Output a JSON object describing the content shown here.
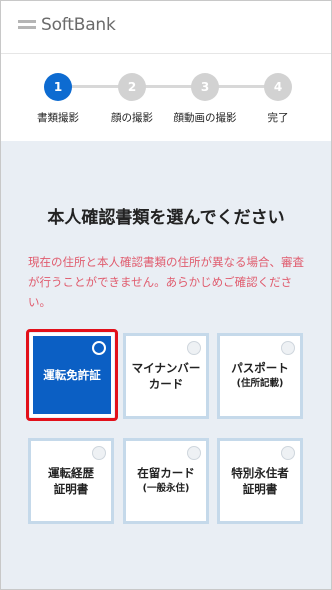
{
  "header": {
    "logo_text": "SoftBank"
  },
  "stepper": {
    "steps": [
      {
        "number": "1",
        "label": "書類撮影"
      },
      {
        "number": "2",
        "label": "顔の撮影"
      },
      {
        "number": "3",
        "label": "顔動画の撮影"
      },
      {
        "number": "4",
        "label": "完了"
      }
    ],
    "active_step": 1
  },
  "main": {
    "title": "本人確認書類を選んでください",
    "notice": "現在の住所と本人確認書類の住所が異なる場合、審査が行うことができません。あらかじめご確認ください。",
    "documents": [
      {
        "line1": "運転免許証",
        "line2": "",
        "selected": true
      },
      {
        "line1": "マイナンバー",
        "line2": "カード",
        "selected": false
      },
      {
        "line1": "パスポート",
        "line2": "(住所記載)",
        "selected": false
      },
      {
        "line1": "運転経歴",
        "line2": "証明書",
        "selected": false
      },
      {
        "line1": "在留カード",
        "line2": "(一般永住)",
        "selected": false
      },
      {
        "line1": "特別永住者",
        "line2": "証明書",
        "selected": false
      }
    ]
  },
  "colors": {
    "accent": "#0d6bd1",
    "selected_outline": "#e2101a",
    "notice": "#e05c6e"
  }
}
